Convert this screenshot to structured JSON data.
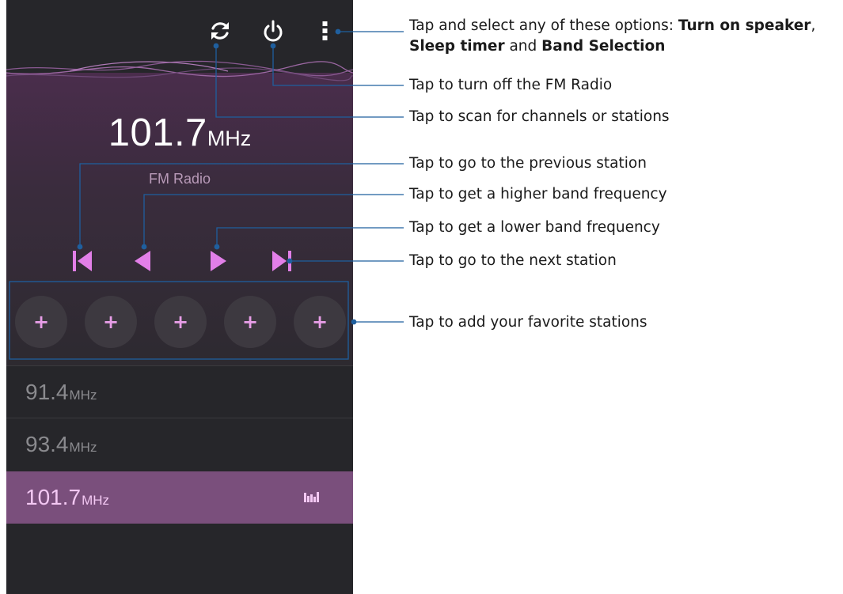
{
  "station": {
    "frequency": "101.7",
    "unit": "MHz",
    "band_label": "FM Radio"
  },
  "toolbar": {
    "scan_icon": "refresh-icon",
    "power_icon": "power-icon",
    "menu_icon": "more-vert-icon"
  },
  "controls": {
    "prev_station_icon": "skip-previous-icon",
    "prev_freq_icon": "arrow-left-icon",
    "next_freq_icon": "arrow-right-icon",
    "next_station_icon": "skip-next-icon"
  },
  "favorites": [
    "+",
    "+",
    "+",
    "+",
    "+"
  ],
  "station_list": [
    {
      "frequency": "91.4",
      "unit": "MHz",
      "active": false
    },
    {
      "frequency": "93.4",
      "unit": "MHz",
      "active": false
    },
    {
      "frequency": "101.7",
      "unit": "MHz",
      "active": true
    }
  ],
  "callouts": {
    "menu_prefix": "Tap and select any of these options: ",
    "menu_opt1": "Turn on speaker",
    "menu_sep1": ",",
    "menu_opt2": "Sleep timer",
    "menu_sep2": " and ",
    "menu_opt3": "Band Selection",
    "power": "Tap to turn off the FM Radio",
    "scan": "Tap to scan for channels or stations",
    "prev_station": "Tap to go to the previous station",
    "higher_band": "Tap to get a higher band frequency",
    "lower_band": "Tap to get a lower band frequency",
    "next_station": "Tap to go to the next station",
    "favorites": "Tap to add your favorite stations"
  },
  "colors": {
    "accent": "#e27fe8",
    "callout_line": "#1f5f9e",
    "screen_bg": "#26262a",
    "active_row": "#7a4f7c"
  }
}
